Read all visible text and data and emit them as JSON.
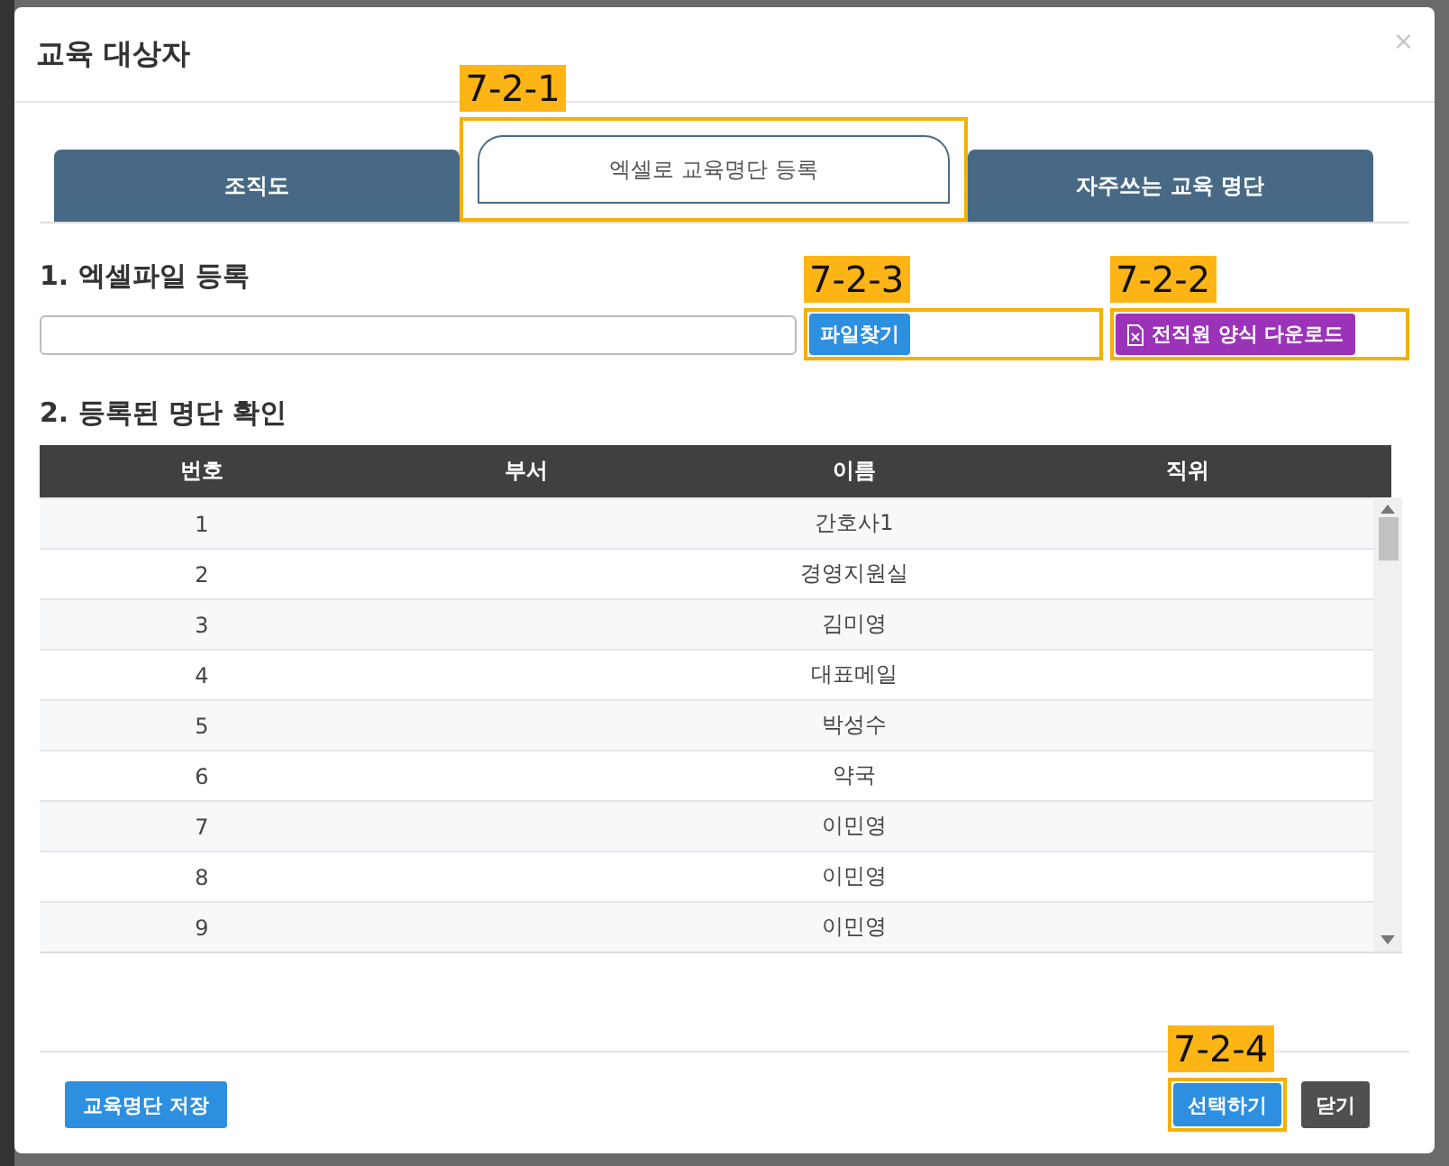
{
  "dialog": {
    "title": "교육 대상자",
    "close": "×"
  },
  "tabs": [
    {
      "label": "조직도",
      "selected": false
    },
    {
      "label": "엑셀로 교육명단 등록",
      "selected": true,
      "callout": "7-2-1"
    },
    {
      "label": "자주쓰는 교육 명단",
      "selected": false
    }
  ],
  "section_1": {
    "heading": "1. 엑셀파일 등록",
    "file_button": {
      "label": "파일찾기",
      "callout": "7-2-3"
    },
    "download_button": {
      "label": "전직원 양식 다운로드",
      "callout": "7-2-2"
    }
  },
  "section_2": {
    "heading": "2. 등록된 명단 확인"
  },
  "table": {
    "columns": [
      "번호",
      "부서",
      "이름",
      "직위"
    ],
    "rows": [
      [
        "1",
        "",
        "간호사1",
        ""
      ],
      [
        "2",
        "",
        "경영지원실",
        ""
      ],
      [
        "3",
        "",
        "김미영",
        ""
      ],
      [
        "4",
        "",
        "대표메일",
        ""
      ],
      [
        "5",
        "",
        "박성수",
        ""
      ],
      [
        "6",
        "",
        "약국",
        ""
      ],
      [
        "7",
        "",
        "이민영",
        ""
      ],
      [
        "8",
        "",
        "이민영",
        ""
      ],
      [
        "9",
        "",
        "이민영",
        ""
      ]
    ]
  },
  "footer": {
    "save_button": "교육명단 저장",
    "select_button": {
      "label": "선택하기",
      "callout": "7-2-4"
    },
    "close_button": "닫기"
  }
}
